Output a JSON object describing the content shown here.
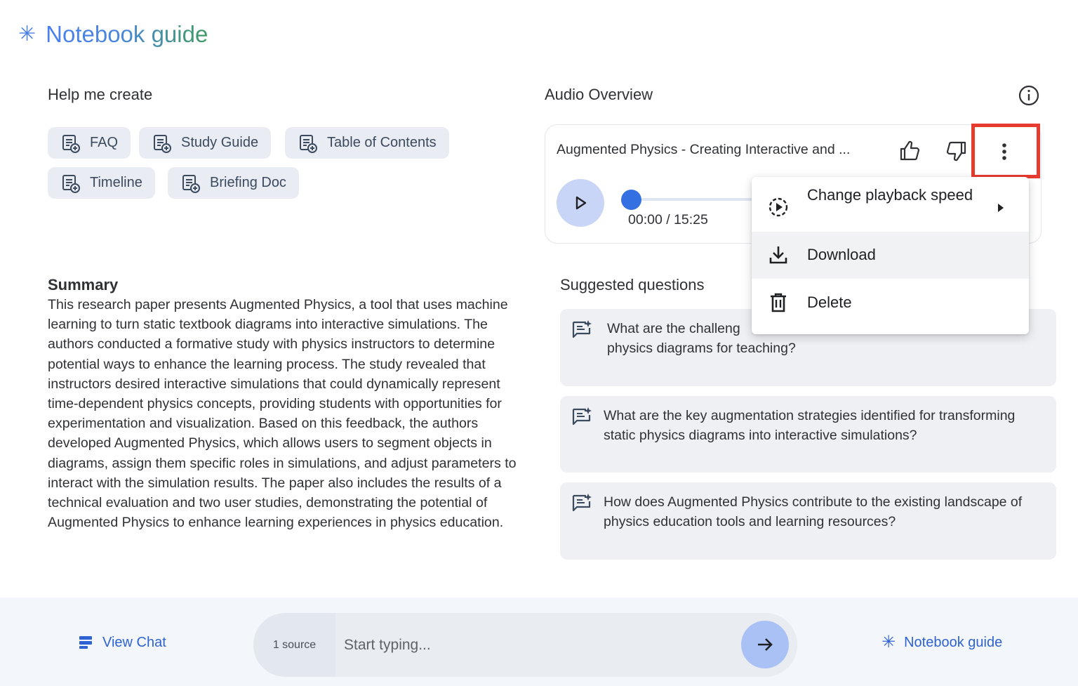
{
  "header": {
    "icon": "sparkle-icon",
    "title": "Notebook guide"
  },
  "help_create": {
    "title": "Help me create",
    "chips": [
      {
        "label": "FAQ",
        "icon": "note-add-icon"
      },
      {
        "label": "Study Guide",
        "icon": "note-add-icon"
      },
      {
        "label": "Table of Contents",
        "icon": "note-add-icon"
      },
      {
        "label": "Timeline",
        "icon": "note-add-icon"
      },
      {
        "label": "Briefing Doc",
        "icon": "note-add-icon"
      }
    ]
  },
  "summary": {
    "title": "Summary",
    "body": "This research paper presents Augmented Physics, a tool that uses machine learning to turn static textbook diagrams into interactive simulations. The authors conducted a formative study with physics instructors to determine potential ways to enhance the learning process. The study revealed that instructors desired interactive simulations that could dynamically represent time-dependent physics concepts, providing students with opportunities for experimentation and visualization. Based on this feedback, the authors developed Augmented Physics, which allows users to segment objects in diagrams, assign them specific roles in simulations, and adjust parameters to interact with the simulation results. The paper also includes the results of a technical evaluation and two user studies, demonstrating the potential of Augmented Physics to enhance learning experiences in physics education."
  },
  "audio": {
    "title": "Audio Overview",
    "track_title": "Augmented Physics - Creating Interactive and ...",
    "time": "00:00 / 15:25",
    "progress": 0
  },
  "menu": {
    "items": [
      {
        "label": "Change playback speed",
        "icon": "playback-speed-icon"
      },
      {
        "label": "Download",
        "icon": "download-icon"
      },
      {
        "label": "Delete",
        "icon": "delete-icon"
      }
    ]
  },
  "suggested": {
    "title": "Suggested questions",
    "questions": [
      "What are the challeng",
      "physics diagrams for teaching?",
      "What are the key augmentation strategies identified for transforming static physics diagrams into interactive simulations?",
      "How does Augmented Physics contribute to the existing landscape of physics education tools and learning resources?"
    ]
  },
  "bottom": {
    "view_chat": "View Chat",
    "source_count": "1 source",
    "placeholder": "Start typing...",
    "notebook_guide": "Notebook guide"
  },
  "colors": {
    "accent": "#2f63d3",
    "highlight": "#e63b2e"
  }
}
